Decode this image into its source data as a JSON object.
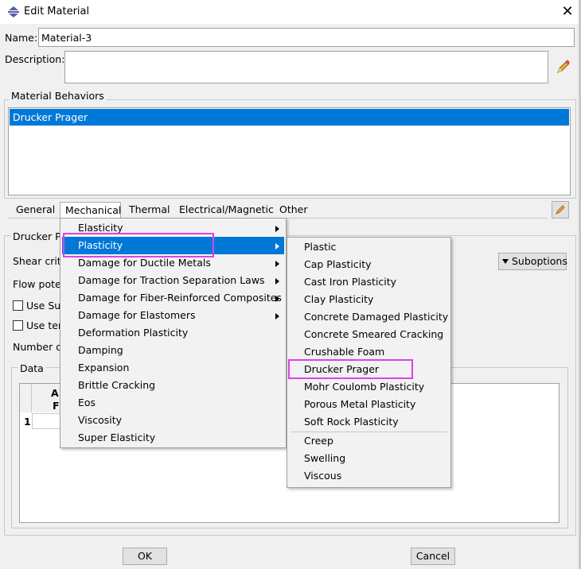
{
  "window": {
    "title": "Edit Material",
    "close": "✕"
  },
  "name": {
    "label": "Name:",
    "value": "Material-3"
  },
  "description": {
    "label": "Description:",
    "value": ""
  },
  "behaviors": {
    "title": "Material Behaviors",
    "items": [
      "Drucker Prager"
    ]
  },
  "tabs": [
    "General",
    "Mechanical",
    "Thermal",
    "Electrical/Magnetic",
    "Other"
  ],
  "section": {
    "title": "Drucker P",
    "rows": [
      "Shear crite",
      "Flow pote",
      "Use Su",
      "Use ter",
      "Number c"
    ],
    "suboptions": "Suboptions",
    "data_title": "Data",
    "col_header": [
      "A",
      "F"
    ],
    "row_num": "1"
  },
  "menu_mechanical": {
    "items": [
      "Elasticity",
      "Plasticity",
      "Damage for Ductile Metals",
      "Damage for Traction Separation Laws",
      "Damage for Fiber-Reinforced Composites",
      "Damage for Elastomers",
      "Deformation Plasticity",
      "Damping",
      "Expansion",
      "Brittle Cracking",
      "Eos",
      "Viscosity",
      "Super Elasticity"
    ],
    "highlighted": "Plasticity"
  },
  "menu_plasticity": {
    "items": [
      "Plastic",
      "Cap Plasticity",
      "Cast Iron Plasticity",
      "Clay Plasticity",
      "Concrete Damaged Plasticity",
      "Concrete Smeared Cracking",
      "Crushable Foam",
      "Drucker Prager",
      "Mohr Coulomb Plasticity",
      "Porous Metal Plasticity",
      "Soft Rock Plasticity"
    ],
    "items2": [
      "Creep",
      "Swelling",
      "Viscous"
    ]
  },
  "buttons": {
    "ok": "OK",
    "cancel": "Cancel"
  },
  "colors": {
    "highlight": "#0078d7",
    "annotation": "#e040e8"
  }
}
